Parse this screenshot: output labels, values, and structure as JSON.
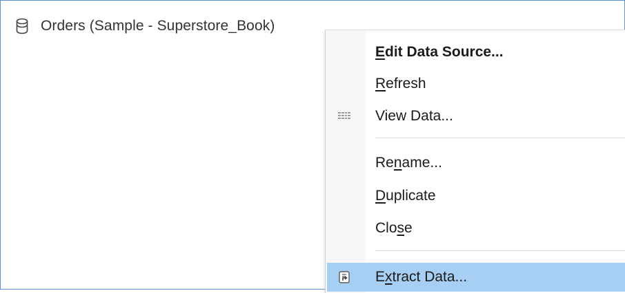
{
  "datasource": {
    "name": "Orders (Sample - Superstore_Book)",
    "icon": "database-icon"
  },
  "context_menu": {
    "items": [
      {
        "pre": "",
        "ul": "E",
        "post": "dit Data Source...",
        "icon": "",
        "bold": true
      },
      {
        "pre": "",
        "ul": "R",
        "post": "efresh",
        "icon": ""
      },
      {
        "pre": "View Data...",
        "ul": "",
        "post": "",
        "icon": "grid-icon"
      },
      {
        "pre": "Re",
        "ul": "n",
        "post": "ame...",
        "icon": ""
      },
      {
        "pre": "",
        "ul": "D",
        "post": "uplicate",
        "icon": ""
      },
      {
        "pre": "Clo",
        "ul": "s",
        "post": "e",
        "icon": ""
      },
      {
        "pre": "E",
        "ul": "x",
        "post": "tract Data...",
        "icon": "extract-icon",
        "highlighted": true
      }
    ]
  },
  "colors": {
    "highlight": "#a7cef3",
    "frame_border": "#5b8fd6"
  }
}
